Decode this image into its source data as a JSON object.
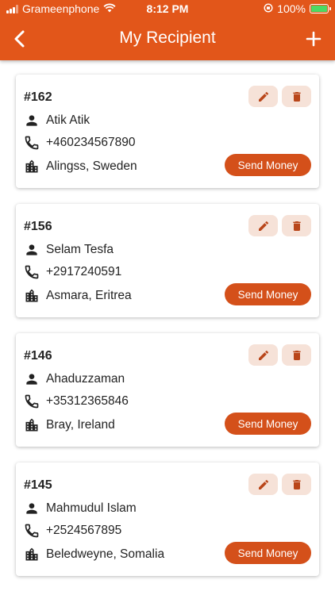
{
  "status_bar": {
    "carrier": "Grameenphone",
    "time": "8:12 PM",
    "battery": "100%"
  },
  "app_bar": {
    "title": "My Recipient",
    "back_icon": "chevron-left-icon",
    "add_icon": "plus-icon"
  },
  "colors": {
    "primary": "#e2561a",
    "button": "#d4501a",
    "icon_button_bg": "#f6e2d8",
    "icon_accent": "#b9461a"
  },
  "recipients": [
    {
      "id": "#162",
      "name": "Atik Atik",
      "phone": "+460234567890",
      "address": "Alingss, Sweden",
      "send_label": "Send Money"
    },
    {
      "id": "#156",
      "name": "Selam Tesfa",
      "phone": "+2917240591",
      "address": "Asmara, Eritrea",
      "send_label": "Send Money"
    },
    {
      "id": "#146",
      "name": "Ahaduzzaman",
      "phone": "+35312365846",
      "address": "Bray, Ireland",
      "send_label": "Send Money"
    },
    {
      "id": "#145",
      "name": "Mahmudul Islam",
      "phone": "+2524567895",
      "address": "Beledweyne, Somalia",
      "send_label": "Send Money"
    }
  ]
}
